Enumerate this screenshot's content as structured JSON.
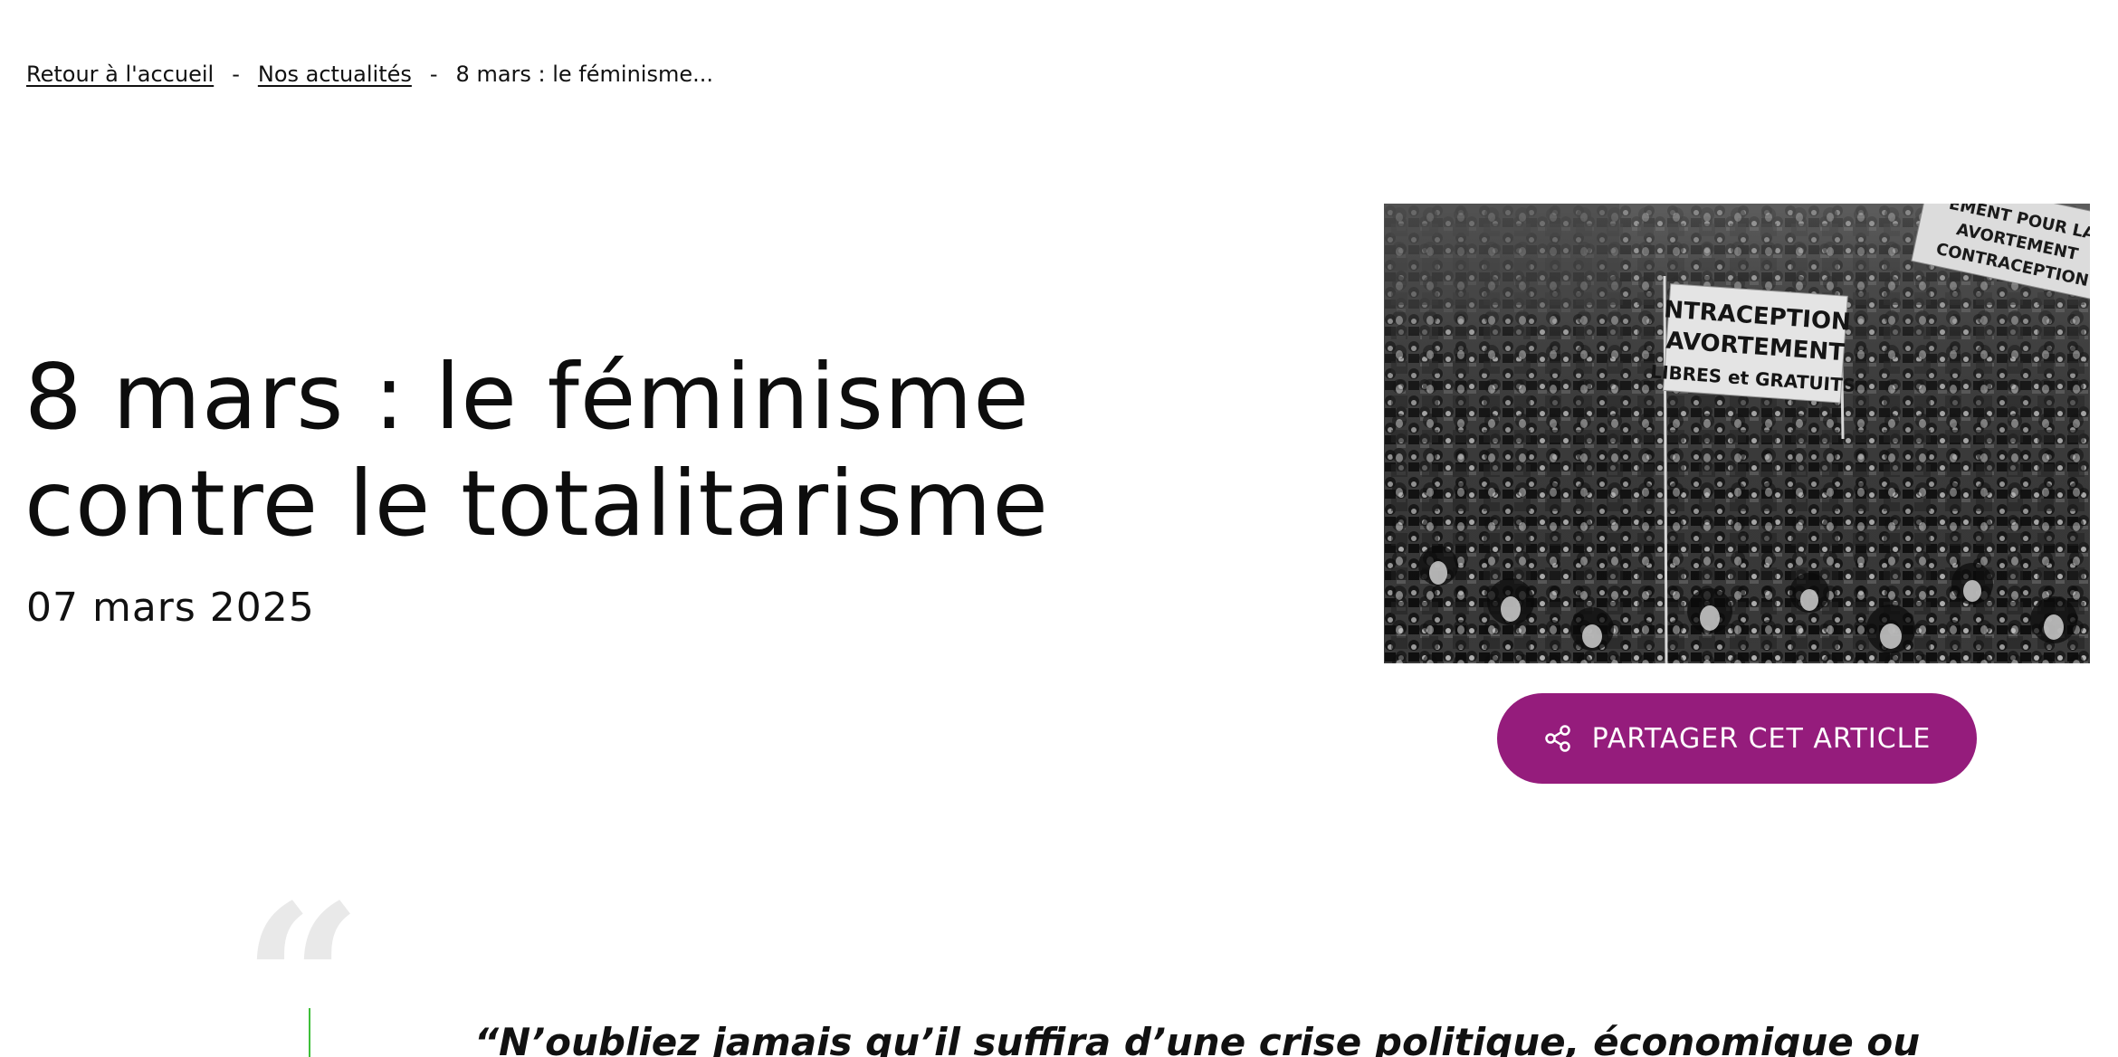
{
  "breadcrumb": {
    "home": "Retour à l'accueil",
    "separator": "-",
    "section": "Nos actualités",
    "current": "8 mars : le féminisme..."
  },
  "article": {
    "title_line1": "8 mars : le féminisme",
    "title_line2": "contre le totalitarisme",
    "date": "07 mars 2025",
    "image": {
      "description_icon": "photo-protest-crowd",
      "banner_main_line1": "NTRACEPTION",
      "banner_main_line2": "AVORTEMENT",
      "banner_main_line3": "LIBRES et GRATUITS",
      "banner_top_line1": "EMENT POUR LA",
      "banner_top_line2": "AVORTEMENT",
      "banner_top_line3": "CONTRACEPTION"
    },
    "share_button_label": "PARTAGER CET ARTICLE",
    "share_icon": "share-icon"
  },
  "quote": {
    "mark": "“",
    "text": "“N’oubliez jamais qu’il suffira d’une crise politique, économique ou"
  },
  "colors": {
    "accent": "#951c7c",
    "quote_bar": "#3fbf3a",
    "quote_mark": "#e9e9e9"
  }
}
